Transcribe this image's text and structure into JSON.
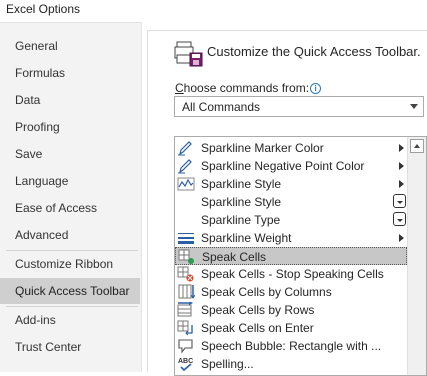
{
  "window": {
    "title": "Excel Options"
  },
  "sidebar": {
    "items": [
      {
        "label": "General"
      },
      {
        "label": "Formulas"
      },
      {
        "label": "Data"
      },
      {
        "label": "Proofing"
      },
      {
        "label": "Save"
      },
      {
        "label": "Language"
      },
      {
        "label": "Ease of Access"
      },
      {
        "label": "Advanced"
      },
      {
        "label": "Customize Ribbon"
      },
      {
        "label": "Quick Access Toolbar",
        "selected": true
      },
      {
        "label": "Add-ins"
      },
      {
        "label": "Trust Center"
      }
    ]
  },
  "main": {
    "header": "Customize the Quick Access Toolbar.",
    "choose_label_underlined": "C",
    "choose_label_rest": "hoose commands from:",
    "info_glyph": "i",
    "commands_select": {
      "value": "All Commands"
    },
    "commands": [
      {
        "label": "Sparkline Marker Color",
        "icon": "pen-icon",
        "marker": "submenu"
      },
      {
        "label": "Sparkline Negative Point Color",
        "icon": "pen-icon",
        "marker": "submenu"
      },
      {
        "label": "Sparkline Style",
        "icon": "sparkline-icon",
        "marker": "submenu"
      },
      {
        "label": "Sparkline Style",
        "icon": "",
        "marker": "dropdown"
      },
      {
        "label": "Sparkline Type",
        "icon": "",
        "marker": "dropdown"
      },
      {
        "label": "Sparkline Weight",
        "icon": "weight-icon",
        "marker": "submenu"
      },
      {
        "label": "Speak Cells",
        "icon": "speak-cells-icon",
        "marker": "",
        "selected": true
      },
      {
        "label": "Speak Cells - Stop Speaking Cells",
        "icon": "speak-stop-icon",
        "marker": ""
      },
      {
        "label": "Speak Cells by Columns",
        "icon": "speak-columns-icon",
        "marker": ""
      },
      {
        "label": "Speak Cells by Rows",
        "icon": "speak-rows-icon",
        "marker": ""
      },
      {
        "label": "Speak Cells on Enter",
        "icon": "speak-enter-icon",
        "marker": ""
      },
      {
        "label": "Speech Bubble: Rectangle with ...",
        "icon": "speech-bubble-icon",
        "marker": ""
      },
      {
        "label": "Spelling...",
        "icon": "spelling-icon",
        "marker": ""
      }
    ]
  },
  "colors": {
    "accent": "#2b78c2",
    "selected_nav": "#cfcfcf",
    "selected_row": "#c7c7c7",
    "sidebar_bg": "#f3f3f3"
  }
}
